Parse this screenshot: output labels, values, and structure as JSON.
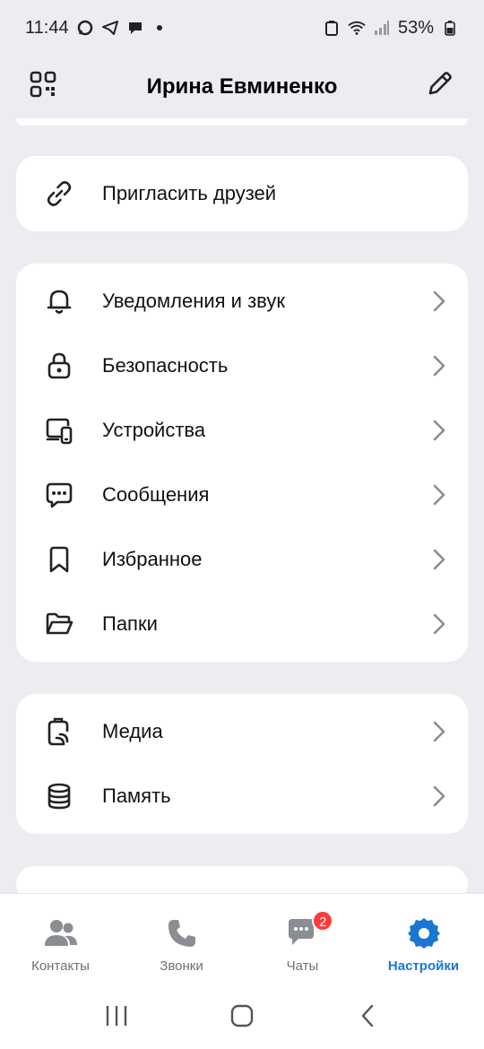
{
  "status_bar": {
    "time": "11:44",
    "battery": "53%",
    "icons_left": [
      "message-bubble-icon",
      "telegram-icon",
      "chat-icon",
      "dot"
    ],
    "icons_right": [
      "battery-saver-icon",
      "wifi-icon",
      "signal-icon",
      "battery-icon"
    ]
  },
  "header": {
    "title": "Ирина Евминенко",
    "left_icon": "qr-code-icon",
    "right_icon": "pencil-icon"
  },
  "cards": [
    {
      "items": [
        {
          "label": "Пригласить друзей",
          "icon": "link-icon",
          "chevron": false
        }
      ]
    },
    {
      "items": [
        {
          "label": "Уведомления и звук",
          "icon": "bell-icon",
          "chevron": true
        },
        {
          "label": "Безопасность",
          "icon": "lock-icon",
          "chevron": true
        },
        {
          "label": "Устройства",
          "icon": "devices-icon",
          "chevron": true
        },
        {
          "label": "Сообщения",
          "icon": "message-icon",
          "chevron": true
        },
        {
          "label": "Избранное",
          "icon": "bookmark-icon",
          "chevron": true
        },
        {
          "label": "Папки",
          "icon": "folder-icon",
          "chevron": true
        }
      ]
    },
    {
      "items": [
        {
          "label": "Медиа",
          "icon": "media-icon",
          "chevron": true
        },
        {
          "label": "Память",
          "icon": "database-icon",
          "chevron": true
        }
      ]
    }
  ],
  "bottom_nav": {
    "items": [
      {
        "label": "Контакты",
        "icon": "contacts-icon",
        "active": false
      },
      {
        "label": "Звонки",
        "icon": "phone-icon",
        "active": false
      },
      {
        "label": "Чаты",
        "icon": "chats-icon",
        "active": false,
        "badge": "2"
      },
      {
        "label": "Настройки",
        "icon": "settings-gear-icon",
        "active": true
      }
    ]
  },
  "colors": {
    "background": "#ebedf0",
    "card": "#ffffff",
    "accent": "#1a76d2",
    "badge": "#ff3b3b",
    "inactive_nav": "#6e7175"
  }
}
